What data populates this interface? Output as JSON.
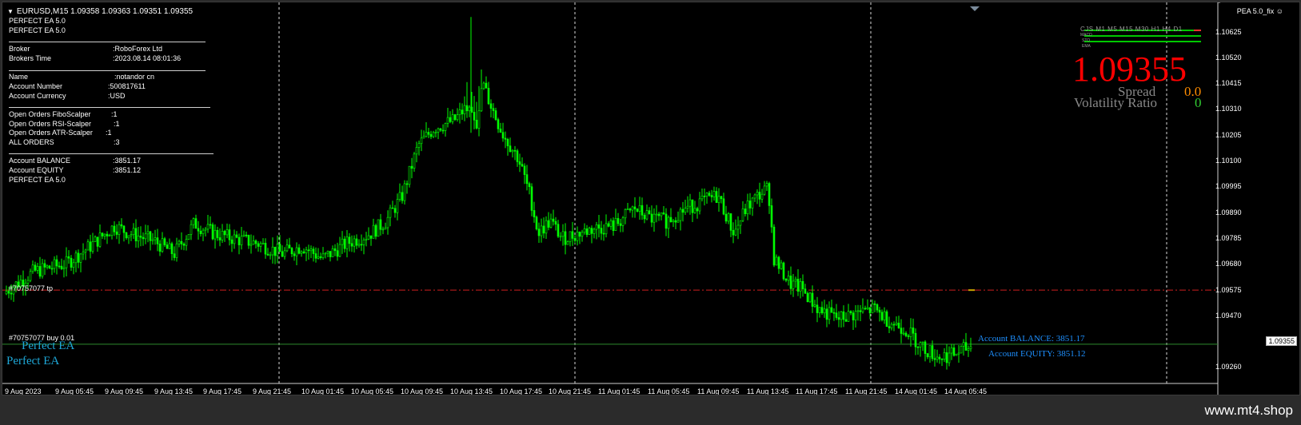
{
  "window": {
    "title": "EURUSD,M15  1.09358 1.09363 1.09351 1.09355",
    "symbol": "EURUSD",
    "timeframe": "M15",
    "ohlc": [
      "1.09358",
      "1.09363",
      "1.09351",
      "1.09355"
    ],
    "ea_name_label": "PEA 5.0_fix"
  },
  "info_panel": {
    "title1": "PERFECT EA 5.0",
    "title2": "PERFECT EA 5.0",
    "broker": {
      "label": "Broker",
      "value": ":RoboForex Ltd"
    },
    "broker_time": {
      "label": "Brokers Time",
      "value": ":2023.08.14 08:01:36"
    },
    "name": {
      "label": "Name",
      "value": ":notandor cn"
    },
    "account_number": {
      "label": "Account Number",
      "value": ":500817611"
    },
    "account_currency": {
      "label": "Account Currency",
      "value": ":USD"
    },
    "open_fibo": {
      "label": "Open Orders FiboScalper",
      "value": ":1"
    },
    "open_rsi": {
      "label": "Open Orders RSI-Scalper",
      "value": ":1"
    },
    "open_atr": {
      "label": "Open Orders ATR-Scalper",
      "value": ":1"
    },
    "all_orders": {
      "label": "ALL ORDERS",
      "value": ":3"
    },
    "balance": {
      "label": "Account BALANCE",
      "value": ":3851.17"
    },
    "equity": {
      "label": "Account EQUITY",
      "value": ":3851.12"
    },
    "footer": "PERFECT EA 5.0"
  },
  "right_panel": {
    "timeframes_header": "CJS  M1  M5  M15  M30  H1  H4  D1",
    "indicator_rows": [
      "MACD",
      "STO",
      "EMA"
    ],
    "price": "1.09355",
    "spread_label": "Spread",
    "spread_value": "0.0",
    "volatility_label": "Volatility Ratio",
    "volatility_value": "0"
  },
  "order_labels": {
    "tp": "#70757077 tp",
    "buy": "#70757077 buy 0.01"
  },
  "watermarks": {
    "small": "Perfect EA",
    "large": "Perfect EA"
  },
  "account_overlay": {
    "balance": "Account BALANCE:  3851.17",
    "equity": "Account EQUITY:  3851.12"
  },
  "price_axis": {
    "labels": [
      "1.10625",
      "1.10520",
      "1.10415",
      "1.10310",
      "1.10205",
      "1.10100",
      "1.09995",
      "1.09890",
      "1.09785",
      "1.09680",
      "1.09575",
      "1.09470",
      "1.09260"
    ],
    "current": "1.09355"
  },
  "time_axis": {
    "labels": [
      "9 Aug 2023",
      "9 Aug 05:45",
      "9 Aug 09:45",
      "9 Aug 13:45",
      "9 Aug 17:45",
      "9 Aug 21:45",
      "10 Aug 01:45",
      "10 Aug 05:45",
      "10 Aug 09:45",
      "10 Aug 13:45",
      "10 Aug 17:45",
      "10 Aug 21:45",
      "11 Aug 01:45",
      "11 Aug 05:45",
      "11 Aug 09:45",
      "11 Aug 13:45",
      "11 Aug 17:45",
      "11 Aug 21:45",
      "14 Aug 01:45",
      "14 Aug 05:45"
    ]
  },
  "chart_data": {
    "type": "candlestick",
    "symbol": "EURUSD",
    "timeframe": "M15",
    "ylim": [
      1.0922,
      1.1068
    ],
    "close_path": [
      [
        0,
        1.0956
      ],
      [
        40,
        1.0965
      ],
      [
        80,
        1.0968
      ],
      [
        110,
        1.0975
      ],
      [
        140,
        1.0983
      ],
      [
        160,
        1.098
      ],
      [
        190,
        1.0977
      ],
      [
        215,
        1.0972
      ],
      [
        240,
        1.0984
      ],
      [
        265,
        1.098
      ],
      [
        290,
        1.0978
      ],
      [
        320,
        1.0976
      ],
      [
        350,
        1.0972
      ],
      [
        375,
        1.0975
      ],
      [
        400,
        1.097
      ],
      [
        430,
        1.0976
      ],
      [
        460,
        1.098
      ],
      [
        480,
        1.0985
      ],
      [
        500,
        1.0995
      ],
      [
        520,
        1.1015
      ],
      [
        540,
        1.1022
      ],
      [
        565,
        1.1025
      ],
      [
        580,
        1.103
      ],
      [
        592,
        1.1022
      ],
      [
        600,
        1.104
      ],
      [
        612,
        1.103
      ],
      [
        625,
        1.102
      ],
      [
        645,
        1.101
      ],
      [
        660,
        1.0995
      ],
      [
        670,
        1.098
      ],
      [
        685,
        1.0985
      ],
      [
        700,
        1.0978
      ],
      [
        720,
        1.098
      ],
      [
        740,
        1.0982
      ],
      [
        765,
        1.0983
      ],
      [
        790,
        1.099
      ],
      [
        810,
        1.0986
      ],
      [
        830,
        1.0985
      ],
      [
        855,
        1.099
      ],
      [
        870,
        1.0992
      ],
      [
        895,
        1.0995
      ],
      [
        915,
        1.098
      ],
      [
        930,
        1.099
      ],
      [
        945,
        1.0995
      ],
      [
        958,
        1.0998
      ],
      [
        965,
        1.097
      ],
      [
        985,
        1.096
      ],
      [
        1000,
        1.0958
      ],
      [
        1020,
        1.095
      ],
      [
        1045,
        1.0946
      ],
      [
        1065,
        1.0948
      ],
      [
        1090,
        1.095
      ],
      [
        1110,
        1.0945
      ],
      [
        1130,
        1.0942
      ],
      [
        1150,
        1.0935
      ],
      [
        1170,
        1.0931
      ],
      [
        1190,
        1.0932
      ],
      [
        1210,
        1.0935
      ]
    ],
    "lines": [
      {
        "name": "#70757077 tp",
        "price": 1.09575,
        "style": "dash-dot",
        "color": "#cc1f1f"
      },
      {
        "name": "#70757077 buy 0.01",
        "price": 1.0936,
        "style": "solid",
        "color": "#2e8b2e"
      }
    ]
  }
}
